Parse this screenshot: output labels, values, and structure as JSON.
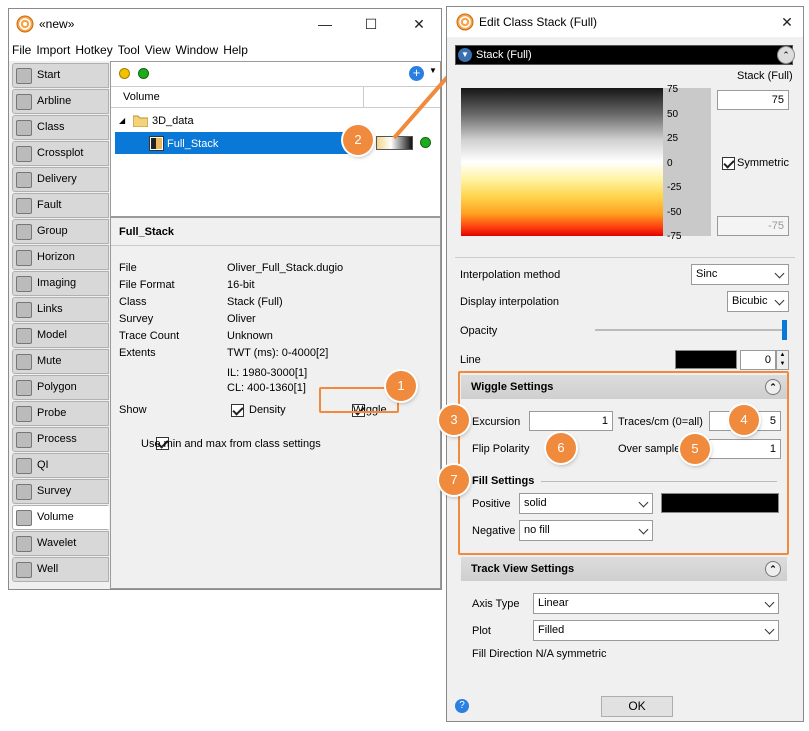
{
  "main_window": {
    "title": "«new»",
    "menu": [
      "File",
      "Import",
      "Hotkey",
      "Tool",
      "View",
      "Window",
      "Help"
    ],
    "nav_items": [
      {
        "label": "Start",
        "icon": "target-icon"
      },
      {
        "label": "Arbline",
        "icon": "arbline-icon"
      },
      {
        "label": "Class",
        "icon": "class-icon"
      },
      {
        "label": "Crossplot",
        "icon": "crossplot-icon"
      },
      {
        "label": "Delivery",
        "icon": "delivery-icon"
      },
      {
        "label": "Fault",
        "icon": "fault-icon"
      },
      {
        "label": "Group",
        "icon": "group-icon"
      },
      {
        "label": "Horizon",
        "icon": "horizon-icon"
      },
      {
        "label": "Imaging",
        "icon": "imaging-icon"
      },
      {
        "label": "Links",
        "icon": "links-icon"
      },
      {
        "label": "Model",
        "icon": "model-icon"
      },
      {
        "label": "Mute",
        "icon": "mute-icon"
      },
      {
        "label": "Polygon",
        "icon": "polygon-icon"
      },
      {
        "label": "Probe",
        "icon": "probe-icon"
      },
      {
        "label": "Process",
        "icon": "process-icon"
      },
      {
        "label": "QI",
        "icon": "qi-icon"
      },
      {
        "label": "Survey",
        "icon": "survey-icon"
      },
      {
        "label": "Volume",
        "icon": "volume-icon"
      },
      {
        "label": "Wavelet",
        "icon": "wavelet-icon"
      },
      {
        "label": "Well",
        "icon": "well-icon"
      }
    ],
    "active_nav": "Volume",
    "tree": {
      "column_header": "Volume",
      "folder": "3D_data",
      "item": "Full_Stack"
    },
    "details": {
      "title": "Full_Stack",
      "rows": [
        {
          "key": "File",
          "value": "Oliver_Full_Stack.dugio"
        },
        {
          "key": "File Format",
          "value": "16-bit"
        },
        {
          "key": "Class",
          "value": "Stack (Full)"
        },
        {
          "key": "Survey",
          "value": "Oliver"
        },
        {
          "key": "Trace Count",
          "value": "Unknown"
        },
        {
          "key": "Extents",
          "value": "TWT (ms): 0-4000[2]"
        }
      ],
      "extents_extra": [
        "IL: 1980-3000[1]",
        "CL: 400-1360[1]"
      ],
      "show_label": "Show",
      "density_label": "Density",
      "wiggle_label": "Wiggle",
      "use_minmax_label": "Use min and max from class settings"
    }
  },
  "dialog": {
    "title": "Edit Class Stack (Full)",
    "colorbar_name": "Stack (Full)",
    "class_label": "Stack (Full)",
    "max_value": "75",
    "min_value": "-75",
    "scale_ticks": [
      "75",
      "50",
      "25",
      "0",
      "-25",
      "-50",
      "-75"
    ],
    "symmetric_label": "Symmetric",
    "interp_method_label": "Interpolation method",
    "interp_method_value": "Sinc",
    "display_interp_label": "Display interpolation",
    "display_interp_value": "Bicubic",
    "opacity_label": "Opacity",
    "line_label": "Line",
    "line_value": "0",
    "wiggle": {
      "header": "Wiggle Settings",
      "excursion_label": "Excursion",
      "excursion_value": "1",
      "traces_label": "Traces/cm (0=all)",
      "traces_value": "5",
      "flip_label": "Flip Polarity",
      "oversample_label": "Over sample",
      "oversample_value": "1",
      "fill_header": "Fill Settings",
      "positive_label": "Positive",
      "positive_value": "solid",
      "negative_label": "Negative",
      "negative_value": "no fill"
    },
    "track": {
      "header": "Track View Settings",
      "axis_label": "Axis Type",
      "axis_value": "Linear",
      "plot_label": "Plot",
      "plot_value": "Filled",
      "fill_direction": "Fill Direction N/A symmetric"
    },
    "ok_label": "OK"
  },
  "badges": [
    "1",
    "2",
    "3",
    "4",
    "5",
    "6",
    "7"
  ],
  "colors": {
    "accent": "#f08a3c",
    "selection": "#0a78d7",
    "status_green": "#1faa1f",
    "status_yellow": "#f2c200"
  }
}
